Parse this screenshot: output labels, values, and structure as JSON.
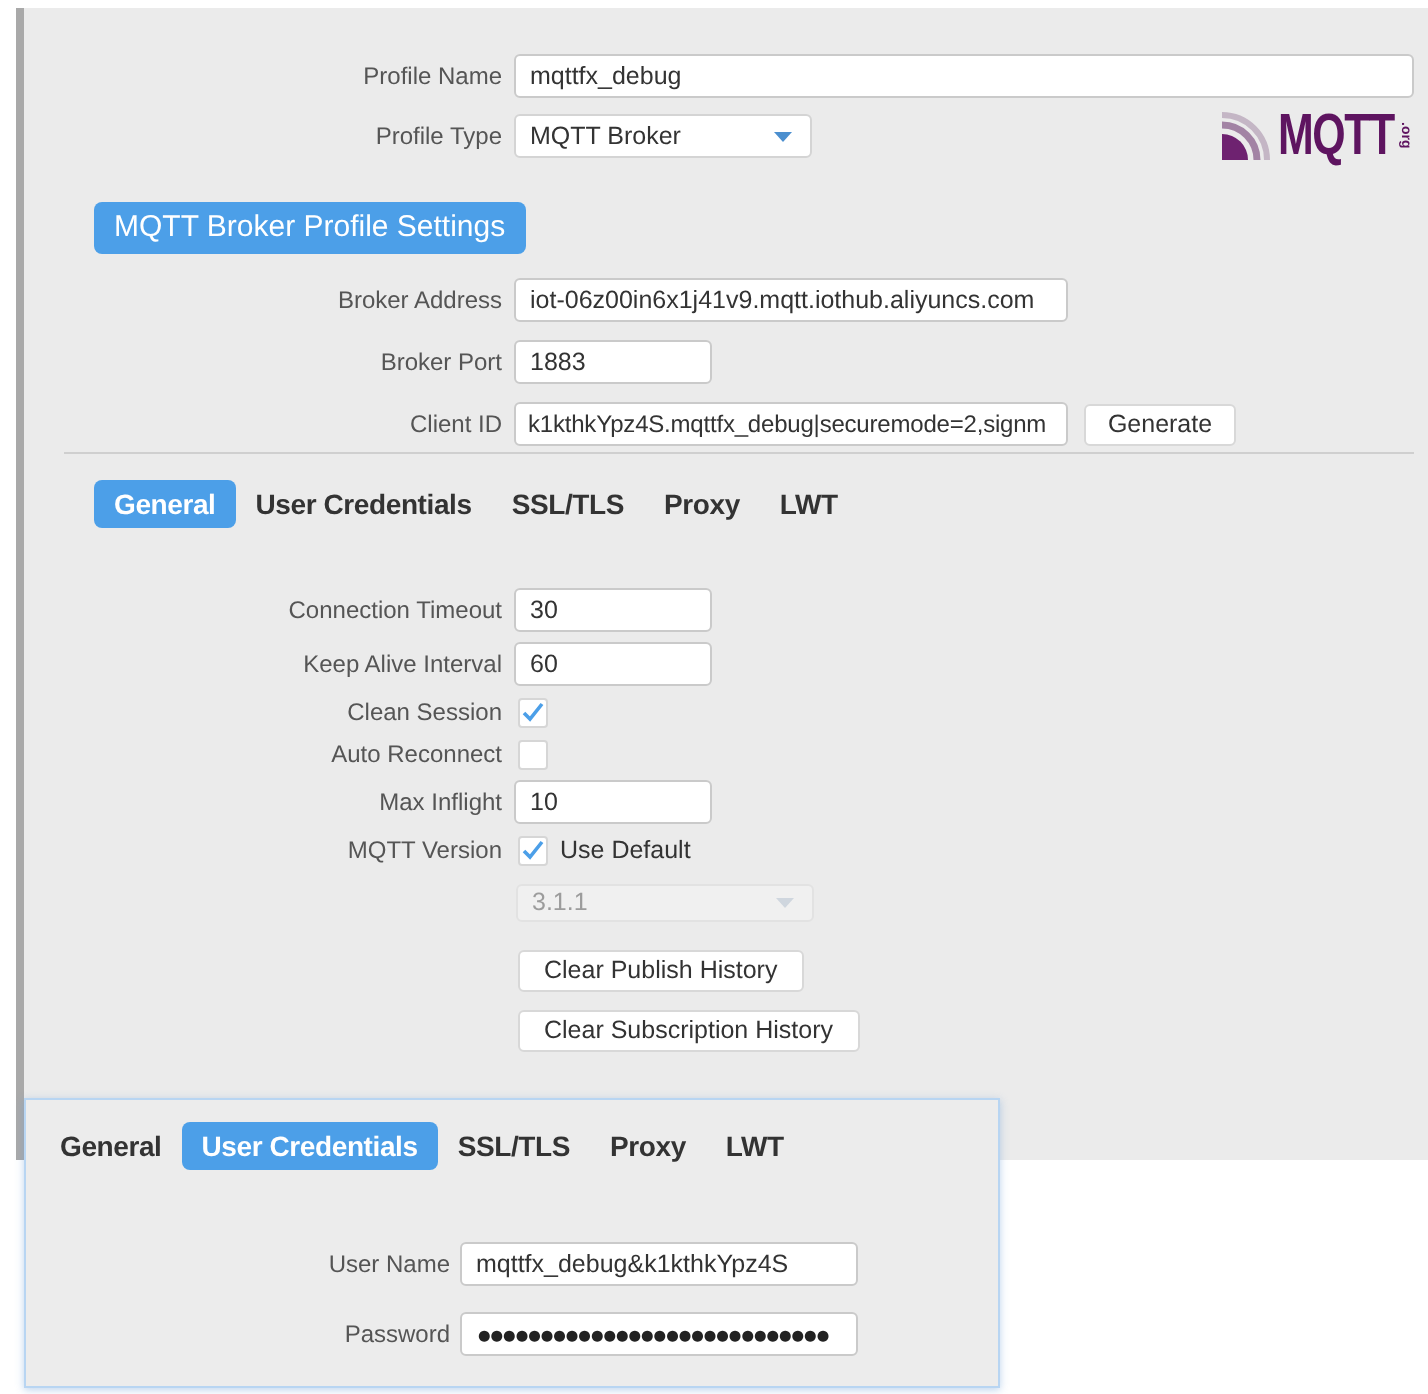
{
  "profile": {
    "name": {
      "label": "Profile Name",
      "value": "mqttfx_debug"
    },
    "type": {
      "label": "Profile Type",
      "value": "MQTT Broker"
    }
  },
  "logo": {
    "text": "MQTT",
    "suffix": ".org"
  },
  "section_button": "MQTT Broker Profile Settings",
  "broker": {
    "address": {
      "label": "Broker Address",
      "value": "iot-06z00in6x1j41v9.mqtt.iothub.aliyuncs.com"
    },
    "port": {
      "label": "Broker Port",
      "value": "1883"
    },
    "client_id": {
      "label": "Client ID",
      "value": "k1kthkYpz4S.mqttfx_debug|securemode=2,signm",
      "button": "Generate"
    }
  },
  "tabs": [
    {
      "label": "General",
      "selected": true
    },
    {
      "label": "User Credentials",
      "selected": false
    },
    {
      "label": "SSL/TLS",
      "selected": false
    },
    {
      "label": "Proxy",
      "selected": false
    },
    {
      "label": "LWT",
      "selected": false
    }
  ],
  "general": {
    "fields": [
      {
        "kind": "text",
        "label": "Connection Timeout",
        "value": "30"
      },
      {
        "kind": "text",
        "label": "Keep Alive Interval",
        "value": "60"
      },
      {
        "kind": "checkbox",
        "label": "Clean Session",
        "checked": true
      },
      {
        "kind": "checkbox",
        "label": "Auto Reconnect",
        "checked": false
      },
      {
        "kind": "text",
        "label": "Max Inflight",
        "value": "10"
      },
      {
        "kind": "checkbox",
        "label": "MQTT Version",
        "checked": true,
        "caption": "Use Default"
      }
    ],
    "version_select": {
      "value": "3.1.1",
      "disabled": true
    },
    "buttons": [
      "Clear Publish History",
      "Clear Subscription History"
    ]
  },
  "credentials_panel": {
    "tabs": [
      {
        "label": "General",
        "selected": false
      },
      {
        "label": "User Credentials",
        "selected": true
      },
      {
        "label": "SSL/TLS",
        "selected": false
      },
      {
        "label": "Proxy",
        "selected": false
      },
      {
        "label": "LWT",
        "selected": false
      }
    ],
    "fields": [
      {
        "kind": "text",
        "label": "User Name",
        "value": "mqttfx_debug&k1kthkYpz4S"
      },
      {
        "kind": "password",
        "label": "Password",
        "value": "●●●●●●●●●●●●●●●●●●●●●●●●●●●●"
      }
    ]
  }
}
